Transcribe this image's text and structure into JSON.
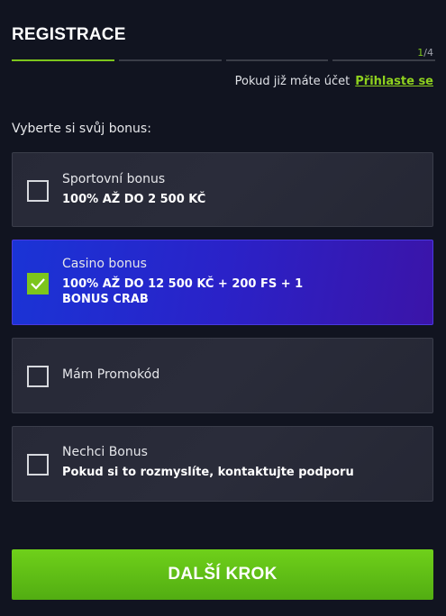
{
  "header": {
    "title": "REGISTRACE",
    "step_current": "1",
    "step_total": "/4"
  },
  "login": {
    "prompt": "Pokud již máte účet",
    "link": "Přihlaste se"
  },
  "bonus_section": {
    "label": "Vyberte si svůj bonus:",
    "options": [
      {
        "title": "Sportovní bonus",
        "subtitle": "100% AŽ DO 2 500 KČ",
        "checked": false
      },
      {
        "title": "Casino bonus",
        "subtitle": "100% AŽ DO 12 500 KČ + 200 FS + 1 BONUS CRAB",
        "checked": true
      },
      {
        "title": "Mám Promokód",
        "subtitle": "",
        "checked": false
      },
      {
        "title": "Nechci Bonus",
        "subtitle": "Pokud si to rozmyslíte, kontaktujte podporu",
        "checked": false
      }
    ]
  },
  "actions": {
    "next_label": "DALŠÍ KROK"
  },
  "colors": {
    "accent_green": "#7dc51c",
    "selected_blue": "#1a34d6",
    "background": "#111420"
  }
}
